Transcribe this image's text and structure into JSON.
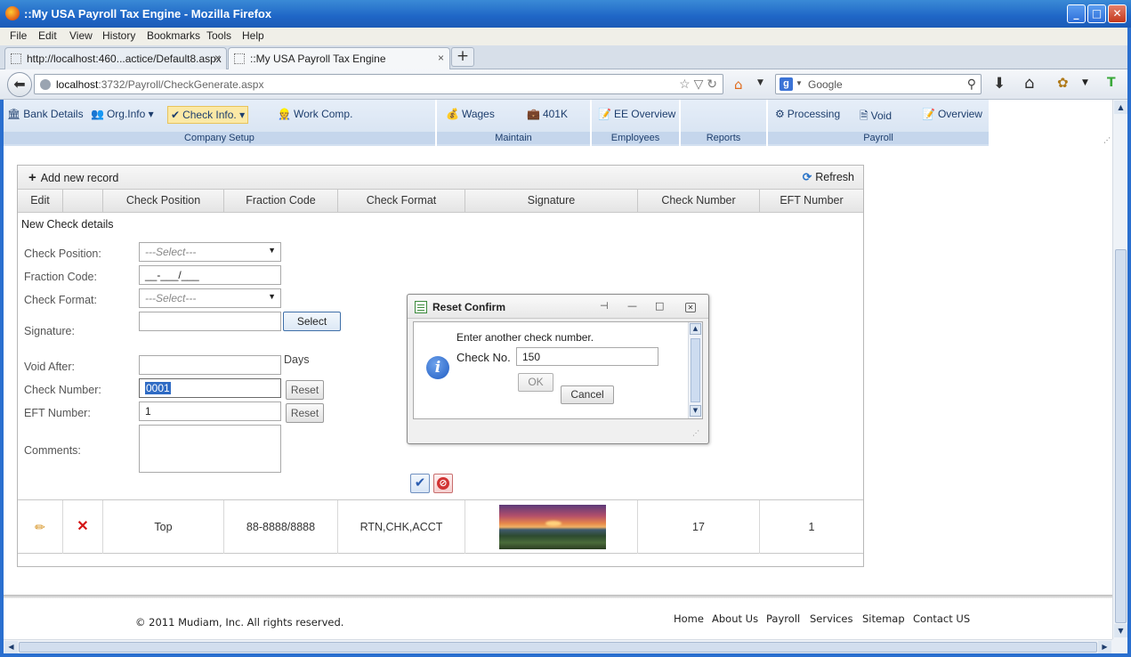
{
  "window": {
    "title": "::My USA Payroll Tax Engine - Mozilla Firefox"
  },
  "menu": [
    "File",
    "Edit",
    "View",
    "History",
    "Bookmarks",
    "Tools",
    "Help"
  ],
  "tabs": [
    {
      "label": "http://localhost:460...actice/Default8.aspx"
    },
    {
      "label": "::My USA Payroll Tax Engine"
    }
  ],
  "tab_close": "×",
  "new_tab": "+",
  "url": {
    "host": "localhost",
    "rest": ":3732/Payroll/CheckGenerate.aspx"
  },
  "search": {
    "placeholder": "Google",
    "engine_icon": "g"
  },
  "ribbon": {
    "company_setup": {
      "label": "Company Setup",
      "items": [
        "Bank Details",
        "Org.Info",
        "Check Info.",
        "Work Comp."
      ]
    },
    "maintain": {
      "label": "Maintain",
      "items": [
        "Wages",
        "401K"
      ]
    },
    "employees": {
      "label": "Employees",
      "items": [
        "EE Overview"
      ]
    },
    "reports": {
      "label": "Reports"
    },
    "payroll": {
      "label": "Payroll",
      "items": [
        "Processing",
        "Void",
        "Overview"
      ]
    }
  },
  "grid": {
    "add_label": "Add new record",
    "refresh_label": "Refresh",
    "columns": [
      "Edit",
      "",
      "Check Position",
      "Fraction Code",
      "Check Format",
      "Signature",
      "Check Number",
      "EFT Number"
    ],
    "form": {
      "title": "New Check details",
      "check_position_label": "Check Position:",
      "check_position_value": "---Select---",
      "fraction_code_label": "Fraction Code:",
      "fraction_code_value": "__-___/___",
      "check_format_label": "Check Format:",
      "check_format_value": "---Select---",
      "signature_label": "Signature:",
      "select_button": "Select",
      "void_after_label": "Void After:",
      "days_label": "Days",
      "check_number_label": "Check Number:",
      "check_number_value": "0001",
      "eft_number_label": "EFT Number:",
      "eft_number_value": "1",
      "comments_label": "Comments:",
      "reset_label": "Reset"
    },
    "row": {
      "check_position": "Top",
      "fraction_code": "88-8888/8888",
      "check_format": "RTN,CHK,ACCT",
      "check_number": "17",
      "eft_number": "1"
    }
  },
  "dialog": {
    "title": "Reset Confirm",
    "message": "Enter another check number.",
    "field_label": "Check No.",
    "field_value": "150",
    "ok": "OK",
    "cancel": "Cancel"
  },
  "footer": {
    "copyright": "© 2011 Mudiam, Inc. All rights reserved.",
    "links": [
      "Home",
      "About Us",
      "Payroll",
      "Services",
      "Sitemap",
      "Contact US"
    ]
  },
  "colors": {
    "titlebar": "#1f66c6",
    "ribbon": "#d4e1f1",
    "selected": "#fbe9a6"
  }
}
